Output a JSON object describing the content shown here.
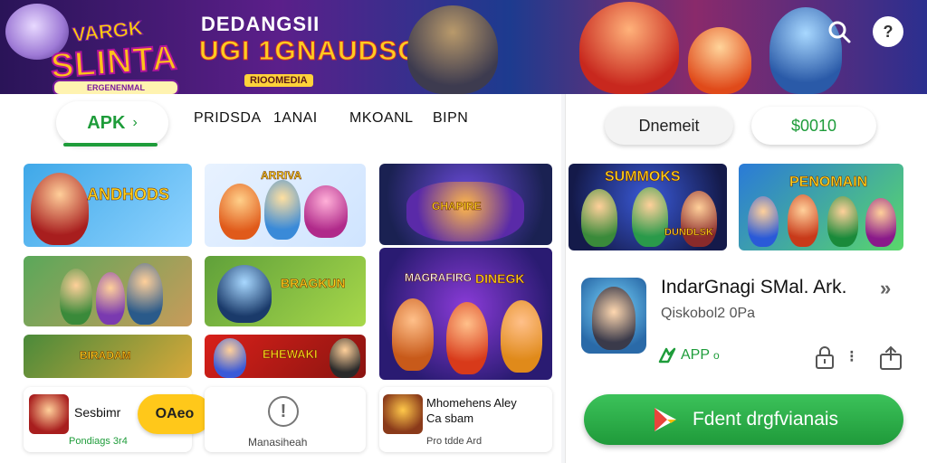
{
  "banner": {
    "logo_line1": "VARGK",
    "logo_line2": "SLINTA",
    "logo_line3": "ERGENENMAL",
    "heading_small": "DEDANGSII",
    "heading_large": "UGI 1GNAUDSO!",
    "heading_badge": "RIOOMEDIA"
  },
  "nav": {
    "apk_tab": "APK",
    "apk_chevron": "›",
    "items": [
      "PRIDSDA",
      "1ANAI",
      "MKOANL",
      "BIPN"
    ]
  },
  "cards": {
    "c1": "ANDHODS",
    "c2": "ARRIVA",
    "c3": "GHAPIRE",
    "c5": "BRAGKUN",
    "c6a": "MAGRAFIRG",
    "c6b": "DINEGK",
    "c7": "BIRADAM",
    "c8": "EHEWAKI"
  },
  "mini_cards": [
    {
      "title": "Sesbimr",
      "sub": "Pondiags 3r4"
    },
    {
      "title": "",
      "sub": "Manasiheah"
    },
    {
      "title": "Mhomehens Aley",
      "title2": "Ca sbam",
      "sub": "Pro tdde Ard"
    }
  ],
  "get_button": "OAeo",
  "alert_symbol": "!",
  "right": {
    "download_pill": "Dnemeit",
    "price_pill": "$0010",
    "card1": "SUMMOKS",
    "card1_sub": "DUNDLSK",
    "card2": "PENOMAIN",
    "app_name": "IndarGnagi SMal. Ark.",
    "app_more": "»",
    "app_sub": "Qiskobol2 0Pa",
    "app_badge": "APP",
    "app_badge_sub": "o",
    "dots": "⁝",
    "download_button": "Fdent drgfvianais"
  }
}
